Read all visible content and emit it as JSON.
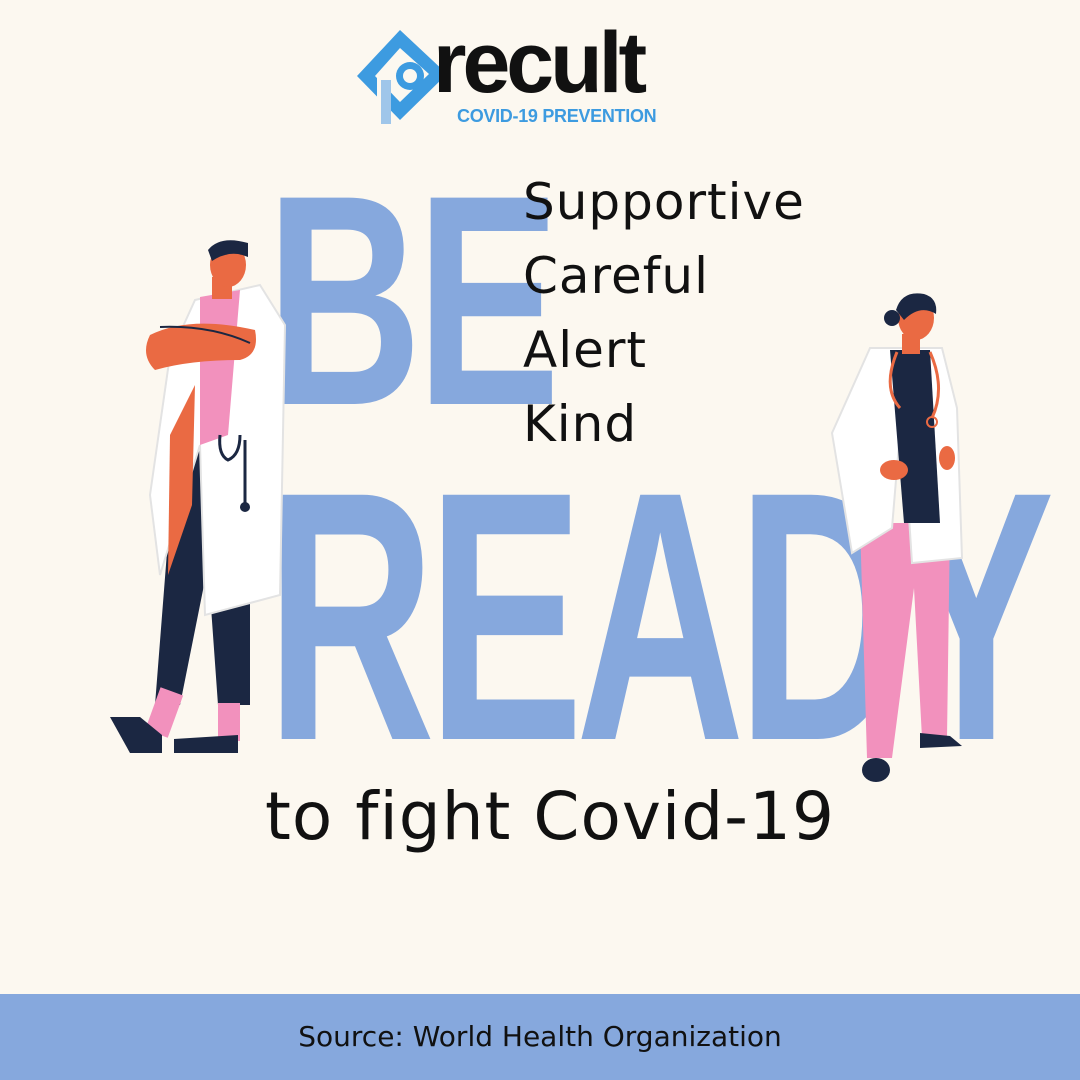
{
  "logo": {
    "wordmark": "recult",
    "subtitle": "COVID-19 PREVENTION",
    "icon": "logo-p-icon",
    "accent_color": "#3d9be0"
  },
  "headline": {
    "line1": "BE",
    "line2": "READY",
    "color": "#86a8dd"
  },
  "qualities": [
    "Supportive",
    "Careful",
    "Alert",
    "Kind"
  ],
  "tagline": "to fight Covid-19",
  "footer": {
    "source": "Source: World Health Organization",
    "color": "#86a8dd"
  },
  "illustrations": {
    "left": "male-doctor-illustration",
    "right": "female-doctor-illustration"
  },
  "colors": {
    "background": "#fcf8f0",
    "text": "#111111",
    "scrub_pink": "#f291bd",
    "navy": "#1b2742",
    "skin": "#ea6a43"
  }
}
